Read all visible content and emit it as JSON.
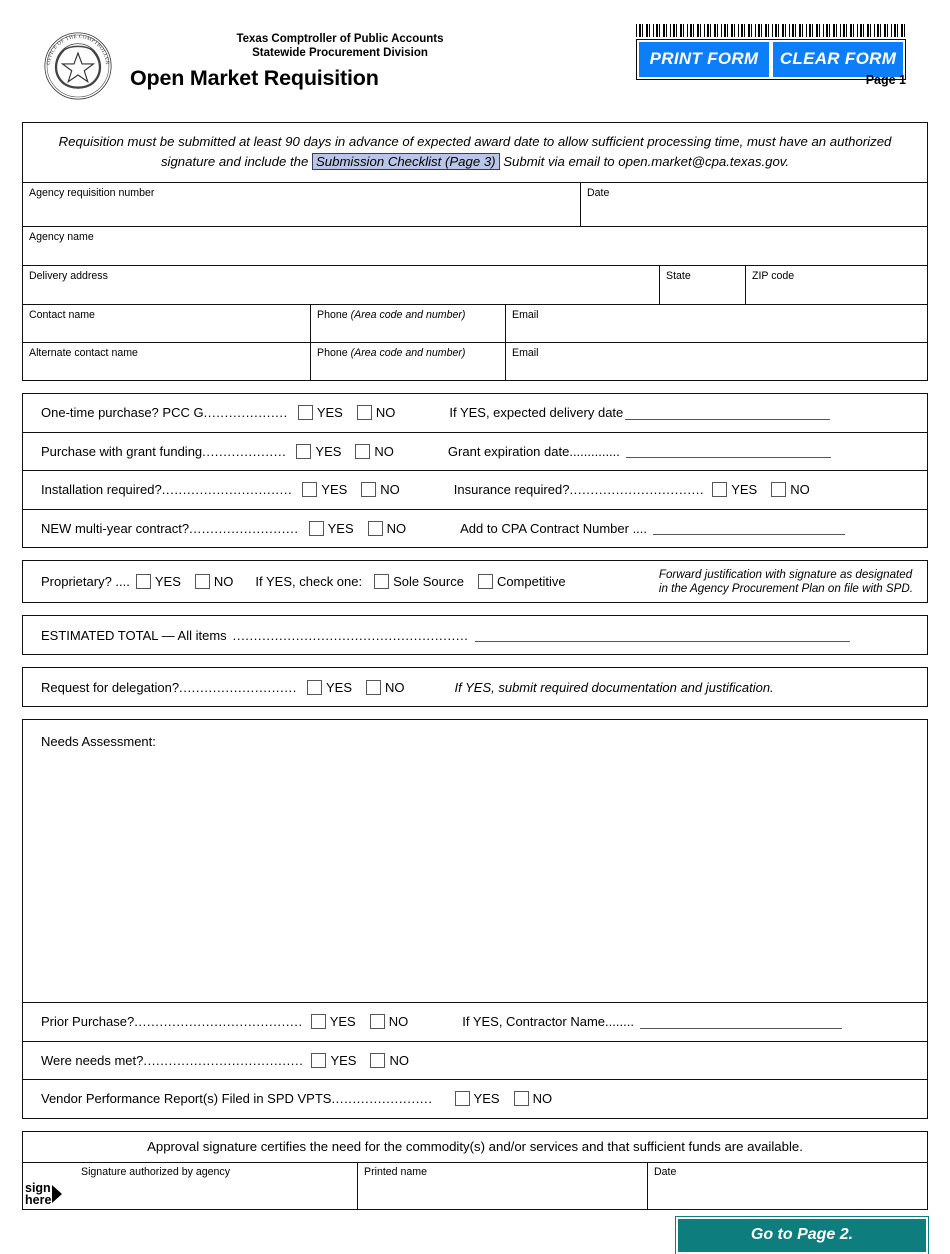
{
  "header": {
    "agency_line1": "Texas Comptroller of Public Accounts",
    "agency_line2": "Statewide Procurement Division",
    "form_title": "Open Market Requisition",
    "page_label": "Page 1",
    "print_button": "PRINT FORM",
    "clear_button": "CLEAR FORM",
    "seal_outer_text": "OFFICE OF THE COMPTROLLER",
    "seal_inner_text": "TEXAS"
  },
  "notice": {
    "part1": "Requisition must be submitted at least 90 days in advance of expected award date to allow sufficient processing time, must have an authorized signature and include the",
    "link": "Submission Checklist (Page 3)",
    "part2": "Submit via email to open.market@cpa.texas.gov."
  },
  "fields": {
    "agency_requisition_number": "Agency requisition number",
    "date": "Date",
    "agency_name": "Agency name",
    "delivery_address": "Delivery address",
    "state": "State",
    "zip_code": "ZIP code",
    "contact_name": "Contact name",
    "phone": "Phone",
    "phone_hint": "(Area code and number)",
    "email": "Email",
    "alternate_contact_name": "Alternate contact name"
  },
  "yes_label": "YES",
  "no_label": "NO",
  "questions": [
    {
      "label": "One-time purchase?  PCC G",
      "dots": "....................",
      "followup": "If YES, expected delivery date"
    },
    {
      "label": "Purchase with grant funding",
      "dots": "....................",
      "followup": "Grant expiration date.............."
    },
    {
      "label": "Installation required?",
      "dots": "...............................",
      "followup": "Insurance required?",
      "followup_dots": "................................",
      "followup_has_checkboxes": true
    },
    {
      "label": "NEW multi-year contract?",
      "dots": "..........................",
      "followup": "Add to CPA Contract Number ...."
    }
  ],
  "proprietary": {
    "label": "Proprietary? ....",
    "check_one": "If YES, check one:",
    "sole_source": "Sole Source",
    "competitive": "Competitive",
    "note_line1": "Forward justification with signature as designated",
    "note_line2": "in the Agency Procurement Plan on file with SPD."
  },
  "estimated_total": {
    "label": "ESTIMATED TOTAL — All items",
    "dots": "........................................................"
  },
  "delegation": {
    "label": "Request for delegation?",
    "dots": "............................",
    "note": "If YES, submit required documentation and justification."
  },
  "needs_assessment": {
    "label": "Needs Assessment:"
  },
  "post_questions": [
    {
      "label": "Prior Purchase?",
      "dots": "........................................",
      "followup": "If YES, Contractor Name........"
    },
    {
      "label": "Were needs met?",
      "dots": "......................................",
      "followup": ""
    },
    {
      "label": "Vendor Performance Report(s) Filed in SPD VPTS",
      "dots": "........................",
      "followup": ""
    }
  ],
  "approval": {
    "statement": "Approval signature certifies the need for the commodity(s) and/or services and that sufficient funds are available.",
    "signature_label": "Signature authorized by agency",
    "printed_name_label": "Printed name",
    "date_label": "Date",
    "sign_here_line1": "sign",
    "sign_here_line2": "here"
  },
  "goto_button": "Go to Page 2.",
  "colors": {
    "form_button_blue": "#0c7ef7",
    "goto_button_teal": "#0d7d7d",
    "link_highlight": "#b9c6e8"
  }
}
